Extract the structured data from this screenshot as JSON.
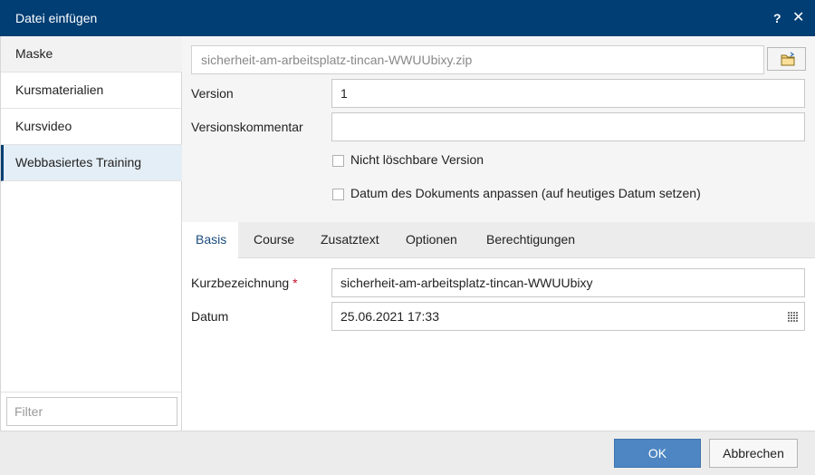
{
  "dialog": {
    "title": "Datei einfügen",
    "help_label": "?",
    "close_label": "✕"
  },
  "sidebar": {
    "items": [
      {
        "label": "Maske"
      },
      {
        "label": "Kursmaterialien"
      },
      {
        "label": "Kursvideo"
      },
      {
        "label": "Webbasiertes Training"
      }
    ],
    "filter_placeholder": "Filter"
  },
  "form": {
    "file_name": "sicherheit-am-arbeitsplatz-tincan-WWUUbixy.zip",
    "version_label": "Version",
    "version_value": "1",
    "comment_label": "Versionskommentar",
    "comment_value": "",
    "nondeletable_label": "Nicht löschbare Version",
    "adjust_date_label": "Datum des Dokuments anpassen (auf heutiges Datum setzen)"
  },
  "tabs": [
    {
      "label": "Basis"
    },
    {
      "label": "Course"
    },
    {
      "label": "Zusatztext"
    },
    {
      "label": "Optionen"
    },
    {
      "label": "Berechtigungen"
    }
  ],
  "basis": {
    "short_name_label": "Kurzbezeichnung",
    "required_mark": "*",
    "short_name_value": "sicherheit-am-arbeitsplatz-tincan-WWUUbixy",
    "date_label": "Datum",
    "date_value": "25.06.2021 17:33"
  },
  "footer": {
    "ok_label": "OK",
    "cancel_label": "Abbrechen"
  },
  "colors": {
    "titlebar": "#003e74",
    "ok_button": "#4d86c2",
    "active_tab_text": "#1a4c7e",
    "required": "#c8102e"
  },
  "icons": {
    "browse": "folder-icon",
    "calendar": "calendar-icon"
  }
}
